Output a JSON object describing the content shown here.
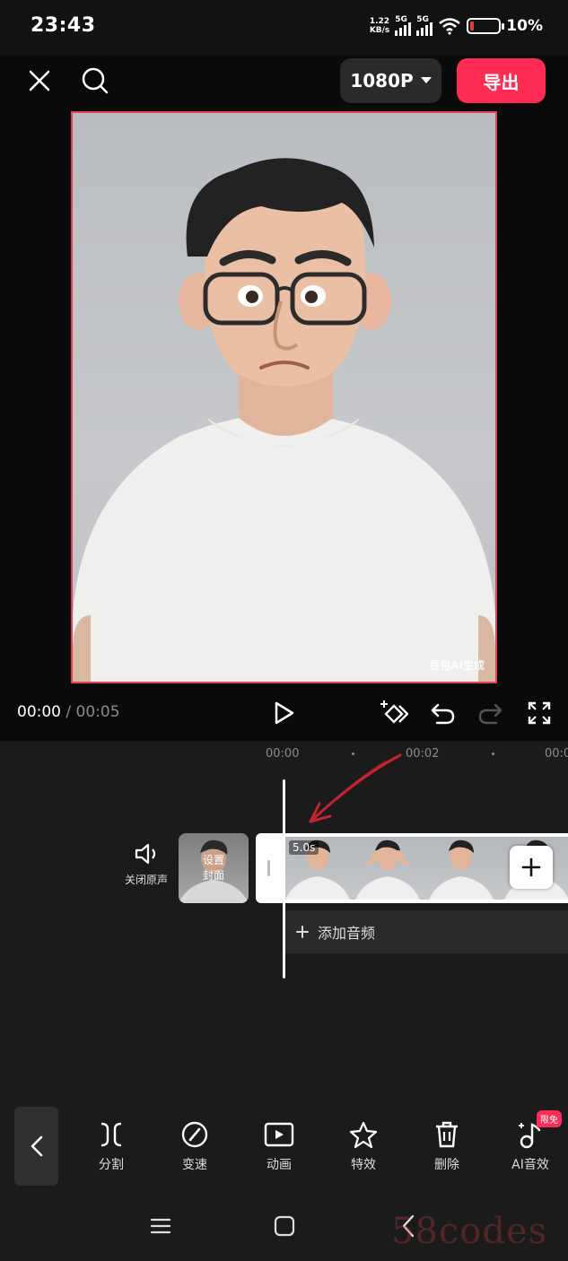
{
  "status_bar": {
    "time": "23:43",
    "net_speed_value": "1.22",
    "net_speed_unit": "KB/s",
    "sim1": "5G",
    "sim2": "5G",
    "battery_text": "10%"
  },
  "top_bar": {
    "resolution": "1080P",
    "export_label": "导出"
  },
  "preview": {
    "watermark": "豆包AI生成"
  },
  "playback": {
    "current_time": "00:00",
    "separator": " / ",
    "total_time": "00:05"
  },
  "timeline": {
    "ruler": [
      "00:00",
      "00:02",
      "00:0"
    ],
    "mute_label": "关闭原声",
    "cover_label_1": "设置",
    "cover_label_2": "封面",
    "clip_duration": "5.0s",
    "add_audio_label": "添加音频"
  },
  "toolbar": {
    "items": [
      {
        "label": "分割",
        "icon": "split-icon"
      },
      {
        "label": "变速",
        "icon": "speed-icon"
      },
      {
        "label": "动画",
        "icon": "animation-icon"
      },
      {
        "label": "特效",
        "icon": "effects-icon"
      },
      {
        "label": "删除",
        "icon": "delete-icon"
      },
      {
        "label": "AI音效",
        "icon": "ai-sound-icon"
      }
    ],
    "badge": "限免"
  },
  "site_watermark": "58codes",
  "colors": {
    "accent": "#fe2c55",
    "background": "#1b1b1b",
    "frame_border": "#e8405a"
  }
}
